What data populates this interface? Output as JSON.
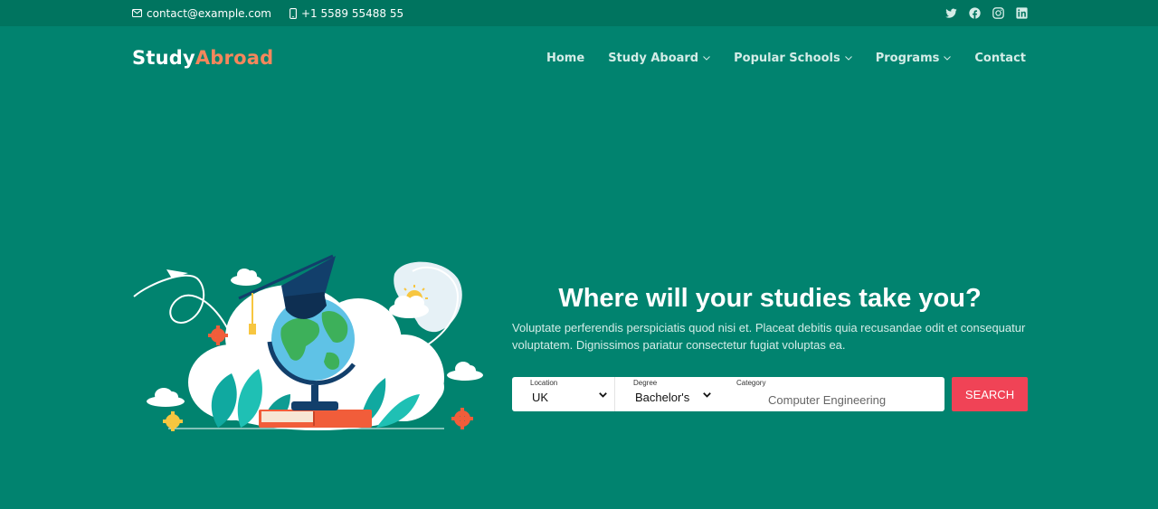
{
  "topbar": {
    "email": "contact@example.com",
    "phone": "+1 5589 55488 55",
    "social": [
      "twitter-icon",
      "facebook-icon",
      "instagram-icon",
      "linkedin-icon"
    ]
  },
  "brand": {
    "part1": "Study",
    "part2": "Abroad",
    "accent_color": "#f5875c"
  },
  "nav": {
    "items": [
      {
        "label": "Home",
        "dropdown": false
      },
      {
        "label": "Study Aboard",
        "dropdown": true
      },
      {
        "label": "Popular Schools",
        "dropdown": true
      },
      {
        "label": "Programs",
        "dropdown": true
      },
      {
        "label": "Contact",
        "dropdown": false
      }
    ]
  },
  "hero": {
    "title": "Where will your studies take you?",
    "description": "Voluptate perferendis perspiciatis quod nisi et. Placeat debitis quia recusandae odit et consequatur voluptatem. Dignissimos pariatur consectetur fugiat voluptas ea."
  },
  "search": {
    "location_label": "Location",
    "location_value": "UK",
    "degree_label": "Degree",
    "degree_value": "Bachelor's",
    "category_label": "Category",
    "category_value": "Computer Engineering",
    "button_label": "SEARCH"
  },
  "colors": {
    "background": "#01836f",
    "topbar": "#00745f",
    "button": "#f04356"
  }
}
